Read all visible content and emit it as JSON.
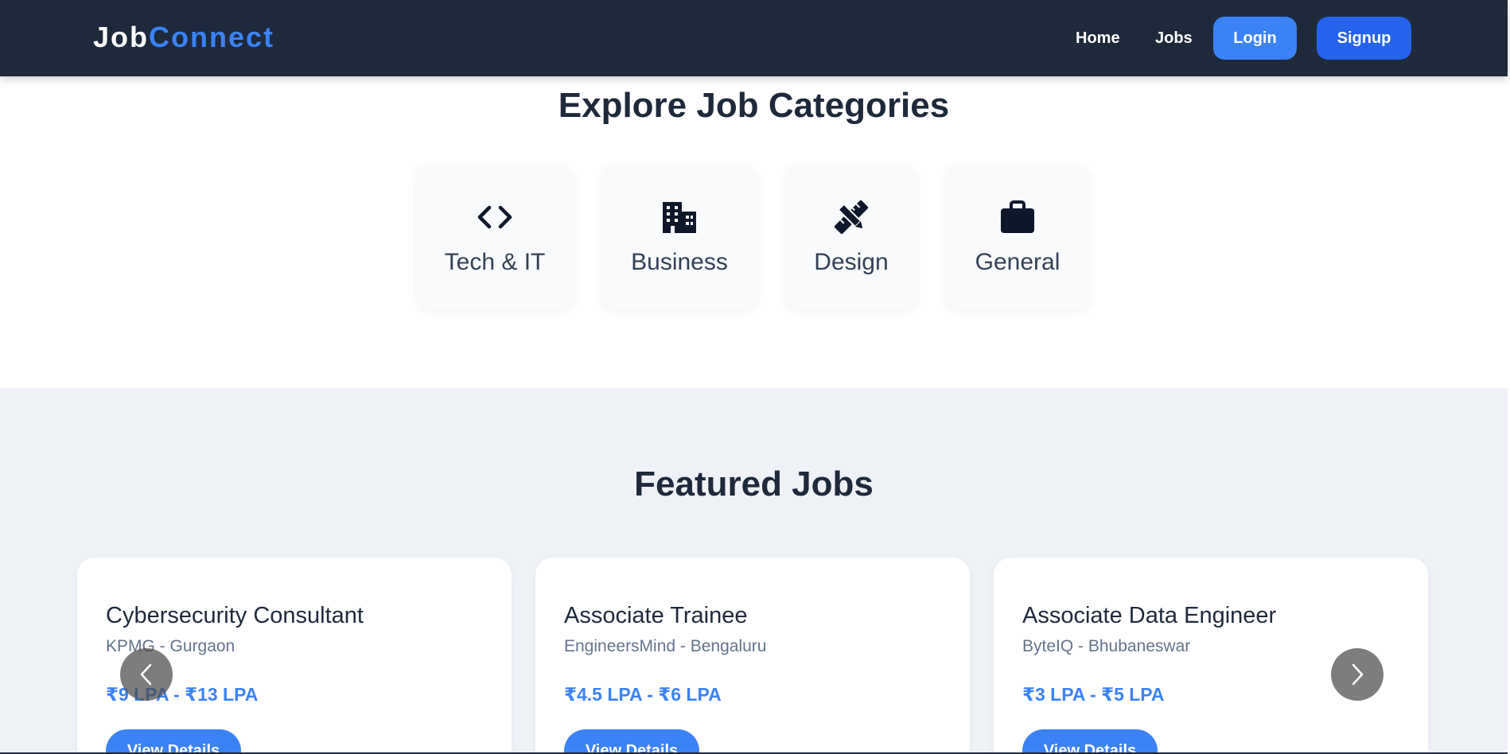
{
  "navbar": {
    "logo_part1": "Job",
    "logo_part2": "Connect",
    "links": {
      "home": "Home",
      "jobs": "Jobs"
    },
    "buttons": {
      "login": "Login",
      "signup": "Signup"
    }
  },
  "categories": {
    "title": "Explore Job Categories",
    "items": [
      {
        "label": "Tech & IT",
        "icon": "code-icon"
      },
      {
        "label": "Business",
        "icon": "building-icon"
      },
      {
        "label": "Design",
        "icon": "pencil-ruler-icon"
      },
      {
        "label": "General",
        "icon": "briefcase-icon"
      }
    ]
  },
  "featured": {
    "title": "Featured Jobs",
    "jobs": [
      {
        "title": "Cybersecurity Consultant",
        "company": "KPMG - Gurgaon",
        "salary": "₹9 LPA - ₹13 LPA",
        "button": "View Details"
      },
      {
        "title": "Associate Trainee",
        "company": "EngineersMind - Bengaluru",
        "salary": "₹4.5 LPA - ₹6 LPA",
        "button": "View Details"
      },
      {
        "title": "Associate Data Engineer",
        "company": "ByteIQ - Bhubaneswar",
        "salary": "₹3 LPA - ₹5 LPA",
        "button": "View Details"
      }
    ]
  },
  "colors": {
    "navbar_bg": "#1e293b",
    "accent": "#3b82f6",
    "accent_dark": "#2563eb",
    "section_bg": "#eef2f7"
  }
}
